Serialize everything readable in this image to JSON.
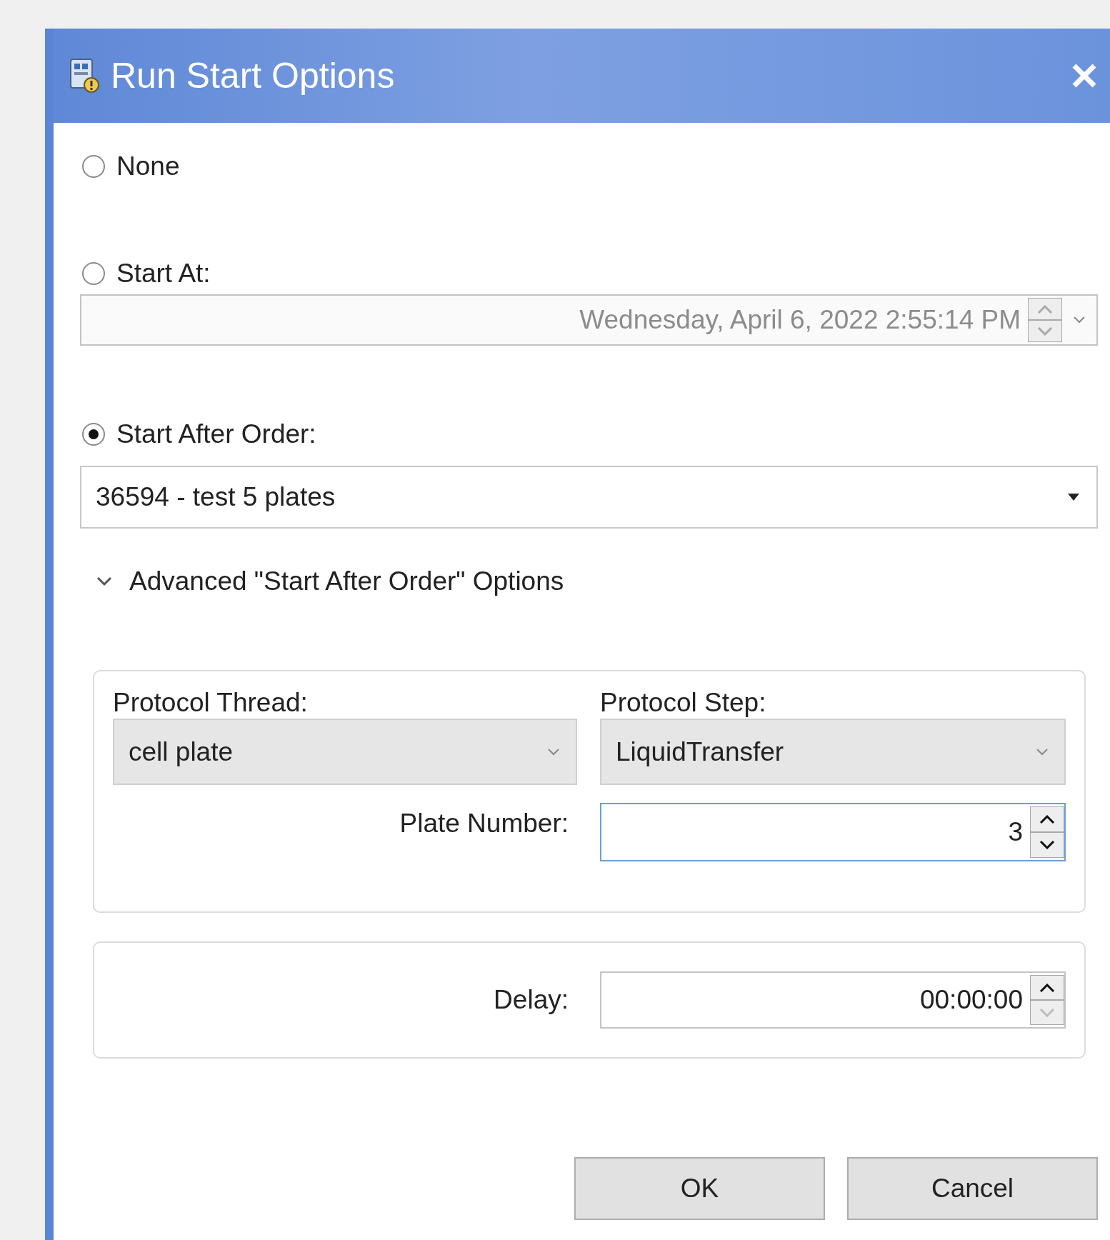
{
  "window": {
    "title": "Run Start Options"
  },
  "options": [
    {
      "label": "None",
      "selected": false
    },
    {
      "label": "Start At:",
      "selected": false
    },
    {
      "label": "Start After Order:",
      "selected": true
    }
  ],
  "start_at": {
    "value": "Wednesday, April 6, 2022 2:55:14 PM",
    "disabled": true
  },
  "order": {
    "value": "36594 - test 5 plates"
  },
  "advanced": {
    "label": "Advanced \"Start After Order\" Options",
    "expanded": true
  },
  "protocol_thread": {
    "label": "Protocol Thread:",
    "value": "cell plate"
  },
  "protocol_step": {
    "label": "Protocol Step:",
    "value": "LiquidTransfer"
  },
  "plate_number": {
    "label": "Plate Number:",
    "value": "3",
    "focused": true
  },
  "delay": {
    "label": "Delay:",
    "value": "00:00:00"
  },
  "buttons": [
    "OK",
    "Cancel"
  ]
}
